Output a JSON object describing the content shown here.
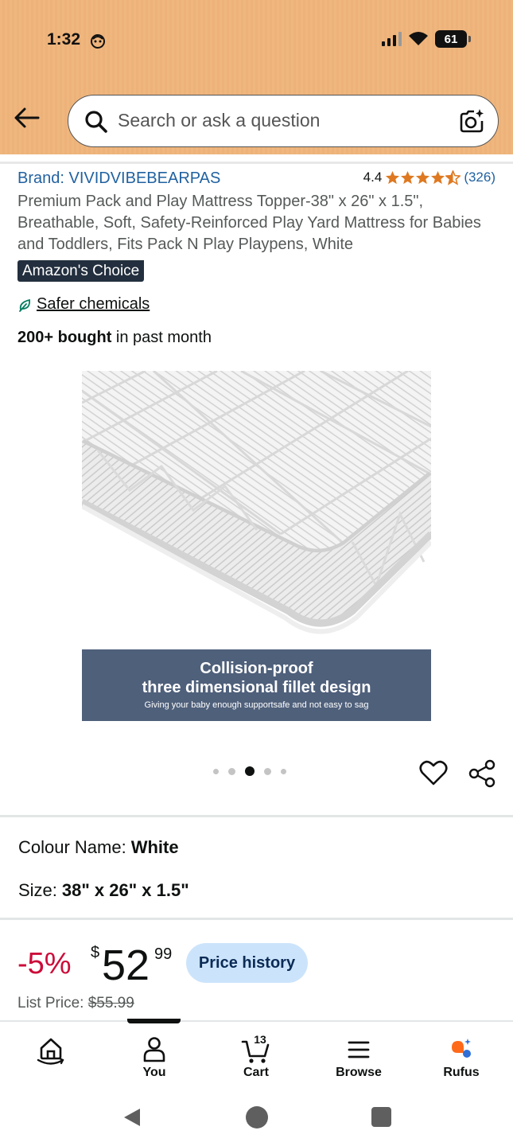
{
  "status_bar": {
    "time": "1:32",
    "battery": "61"
  },
  "search": {
    "placeholder": "Search or ask a question"
  },
  "product": {
    "brand": "Brand: VIVIDVIBEBEARPAS",
    "rating": "4.4",
    "rating_count": "(326)",
    "stars_value": 4.4,
    "title": "Premium Pack and Play Mattress Topper-38\" x 26\" x 1.5\", Breathable, Soft, Safety-Reinforced Play Yard Mattress for Babies and Toddlers, Fits Pack N Play Playpens, White",
    "badge": "Amazon's Choice",
    "safer_chemicals": "Safer chemicals",
    "bought_bold": "200+ bought",
    "bought_rest": " in past month",
    "image_banner": {
      "line1": "Collision-proof",
      "line2": "three dimensional fillet design",
      "line3": "Giving your baby enough supportsafe and not easy to sag"
    },
    "carousel": {
      "count": 5,
      "active_index": 2
    },
    "colour_label": "Colour Name:",
    "colour_value": "White",
    "size_label": "Size:",
    "size_value": "38\" x 26\" x 1.5\"",
    "discount": "-5%",
    "price_symbol": "$",
    "price_whole": "52",
    "price_fraction": "99",
    "price_history_label": "Price history",
    "list_price_label": "List Price:",
    "list_price_value": "$55.99"
  },
  "nav": {
    "items": [
      {
        "label": "",
        "icon": "home-icon"
      },
      {
        "label": "You",
        "icon": "person-icon"
      },
      {
        "label": "Cart",
        "icon": "cart-icon",
        "count": "13"
      },
      {
        "label": "Browse",
        "icon": "menu-icon"
      },
      {
        "label": "Rufus",
        "icon": "rufus-icon"
      }
    ]
  },
  "colors": {
    "header": "#efb67d",
    "link": "#2162a1",
    "discount": "#cc0c39",
    "badge": "#232f3e",
    "star": "#de7921",
    "price_history_bg": "#cce4fb",
    "banner": "#4f607b"
  }
}
